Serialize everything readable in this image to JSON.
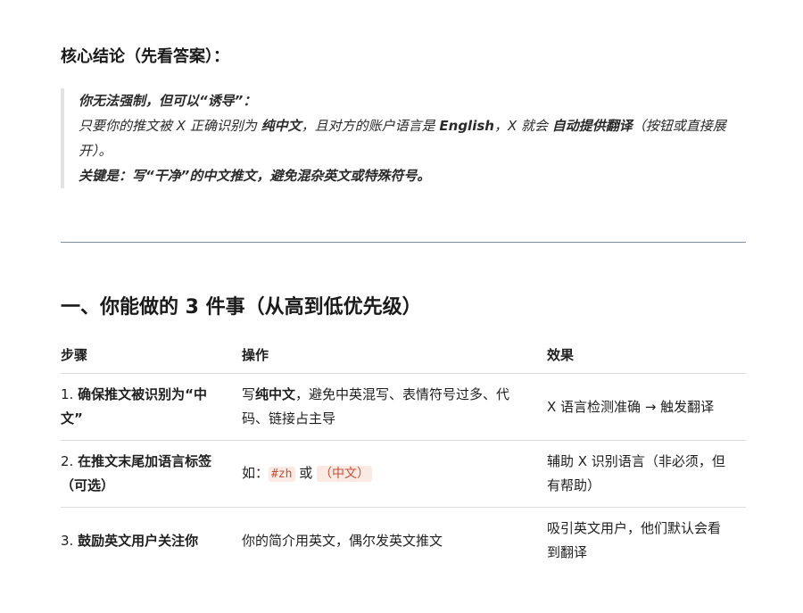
{
  "conclusion_heading": "核心结论（先看答案）：",
  "quote": {
    "line1_bold": "你无法强制，但可以“诱导”：",
    "line2_part1": "只要你的推文被 X 正确识别为 ",
    "line2_bold1": "纯中文",
    "line2_part2": "，且对方的账户语言是 ",
    "line2_bold2": "English",
    "line2_part3": "，X 就会 ",
    "line2_bold3": "自动提供翻译",
    "line2_part4": "（按钮或直接展开）。",
    "line3_bold": "关键是：写“干净”的中文推文，避免混杂英文或特殊符号。"
  },
  "section_heading": "一、你能做的 3 件事（从高到低优先级）",
  "table": {
    "headers": [
      "步骤",
      "操作",
      "效果"
    ],
    "row1": {
      "num": "1. ",
      "step": "确保推文被识别为“中文”",
      "action_pre": "写",
      "action_bold": "纯中文",
      "action_post": "，避免中英混写、表情符号过多、代码、链接占主导",
      "effect": "X 语言检测准确 → 触发翻译"
    },
    "row2": {
      "num": "2. ",
      "step": "在推文末尾加语言标签（可选）",
      "action_pre": "如：",
      "code1": "#zh",
      "action_mid": " 或 ",
      "code2": "（中文）",
      "effect": "辅助 X 识别语言（非必须，但有帮助）"
    },
    "row3": {
      "num": "3. ",
      "step": "鼓励英文用户关注你",
      "action": "你的简介用英文，偶尔发英文推文",
      "effect": "吸引英文用户，他们默认会看到翻译"
    }
  }
}
